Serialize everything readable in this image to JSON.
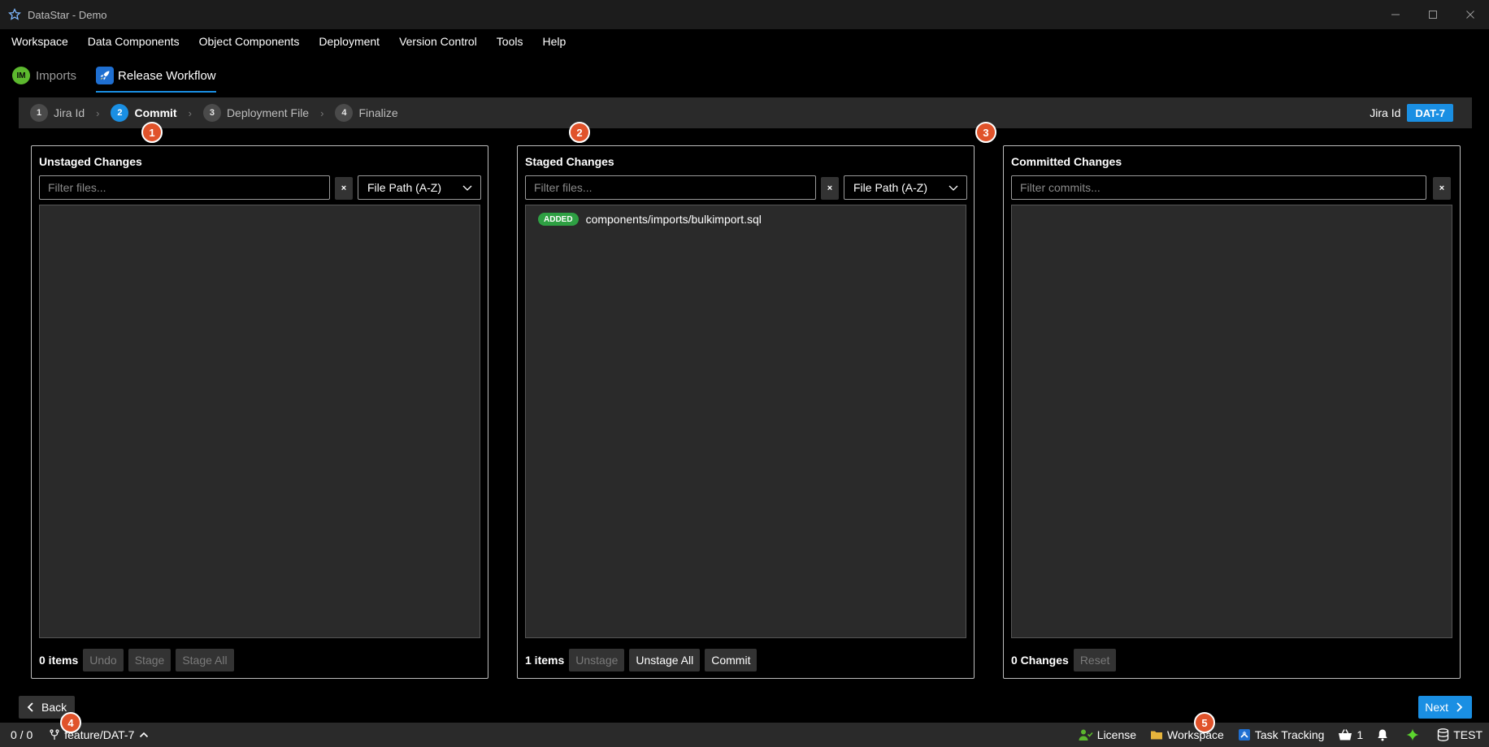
{
  "window": {
    "title": "DataStar - Demo",
    "controls": {
      "minimize": "—",
      "maximize": "☐",
      "close": "✕"
    }
  },
  "menu": [
    "Workspace",
    "Data Components",
    "Object Components",
    "Deployment",
    "Version Control",
    "Tools",
    "Help"
  ],
  "tabs": [
    {
      "badge": "IM",
      "label": "Imports",
      "active": false
    },
    {
      "label": "Release Workflow",
      "active": true,
      "icon": "rocket-icon"
    }
  ],
  "stepper": {
    "steps": [
      {
        "num": "1",
        "label": "Jira Id"
      },
      {
        "num": "2",
        "label": "Commit"
      },
      {
        "num": "3",
        "label": "Deployment File"
      },
      {
        "num": "4",
        "label": "Finalize"
      }
    ],
    "active_step": 2,
    "separator": "›",
    "jira_label": "Jira Id",
    "jira_value": "DAT-7"
  },
  "markers": [
    "1",
    "2",
    "3",
    "4",
    "5"
  ],
  "panels": {
    "unstaged": {
      "title": "Unstaged Changes",
      "filter_placeholder": "Filter files...",
      "clear": "×",
      "sort": "File Path (A-Z)",
      "count": "0 items",
      "buttons": [
        "Undo",
        "Stage",
        "Stage All"
      ]
    },
    "staged": {
      "title": "Staged Changes",
      "filter_placeholder": "Filter files...",
      "clear": "×",
      "sort": "File Path (A-Z)",
      "files": [
        {
          "status": "ADDED",
          "path": "components/imports/bulkimport.sql"
        }
      ],
      "count": "1 items",
      "buttons": [
        "Unstage",
        "Unstage All",
        "Commit"
      ]
    },
    "committed": {
      "title": "Committed Changes",
      "filter_placeholder": "Filter commits...",
      "clear": "×",
      "count": "0 Changes",
      "buttons": [
        "Reset"
      ]
    }
  },
  "nav": {
    "back": "Back",
    "next": "Next"
  },
  "statusbar": {
    "sync": "0 / 0",
    "branch": "feature/DAT-7",
    "license": "License",
    "workspace": "Workspace",
    "task_tracking": "Task Tracking",
    "basket_count": "1",
    "environment": "TEST"
  },
  "colors": {
    "accent": "#1a8fe3",
    "added": "#2ea043",
    "marker": "#e0532b",
    "im_badge": "#5cb82e"
  }
}
